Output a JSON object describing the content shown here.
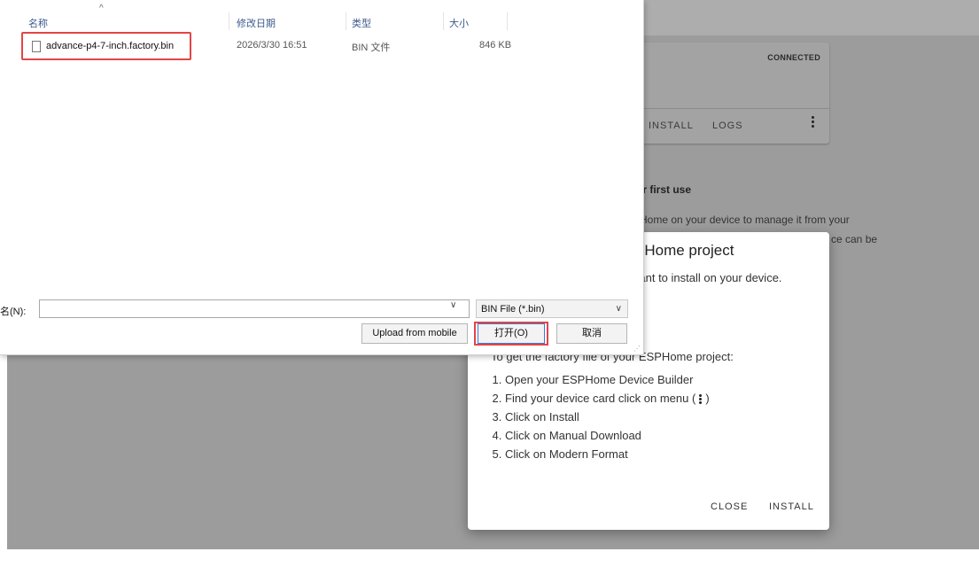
{
  "colors": {
    "overlay": "#9c9c9c",
    "highlight": "#e34545",
    "column_header_text": "#3d5b8c",
    "primary_button_border": "#3c79d8"
  },
  "background": {
    "device_card": {
      "status": "CONNECTED",
      "install": "INSTALL",
      "logs": "LOGS",
      "menu_icon": "kebab-menu-icon"
    },
    "intro": {
      "title": "for first use",
      "line1": "PHome on your device to manage it from your",
      "line2": "ce can be"
    }
  },
  "dialog": {
    "title": "PHome project",
    "subtitle": "want to install on your device.",
    "instructions_intro": "To get the factory file of your ESPHome project:",
    "steps": [
      "Open your ESPHome Device Builder",
      "Find your device card click on menu (",
      "Click on Install",
      "Click on Manual Download",
      "Click on Modern Format"
    ],
    "step2_suffix": ")",
    "close_label": "CLOSE",
    "install_label": "INSTALL"
  },
  "file_dialog": {
    "columns": {
      "name": "名称",
      "date": "修改日期",
      "type": "类型",
      "size": "大小"
    },
    "files": [
      {
        "name": "advance-p4-7-inch.factory.bin",
        "date": "2026/3/30 16:51",
        "type": "BIN 文件",
        "size": "846 KB"
      }
    ],
    "filename_label": "名(N):",
    "filename_value": "",
    "filetype": "BIN File (*.bin)",
    "upload_label": "Upload from mobile",
    "open_label": "打开(O)",
    "cancel_label": "取消"
  }
}
